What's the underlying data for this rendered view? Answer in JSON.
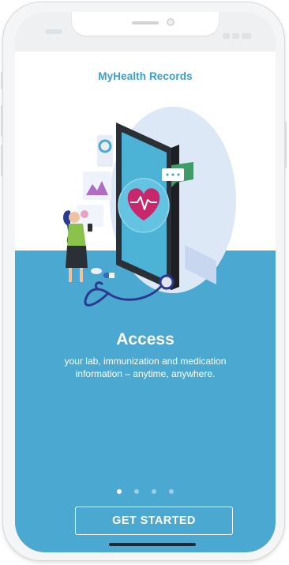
{
  "app": {
    "title": "MyHealth Records"
  },
  "slide": {
    "title": "Access",
    "description": "your lab, immunization and medication information – anytime, anywhere.",
    "page_index": 1,
    "page_count": 4
  },
  "actions": {
    "get_started_label": "GET STARTED"
  },
  "colors": {
    "accent": "#3a9fd0",
    "panel": "#4ba8d0",
    "heart": "#c8286b"
  },
  "icons": [
    "heart-pulse-icon",
    "chat-bubble-icon",
    "stethoscope-icon"
  ]
}
